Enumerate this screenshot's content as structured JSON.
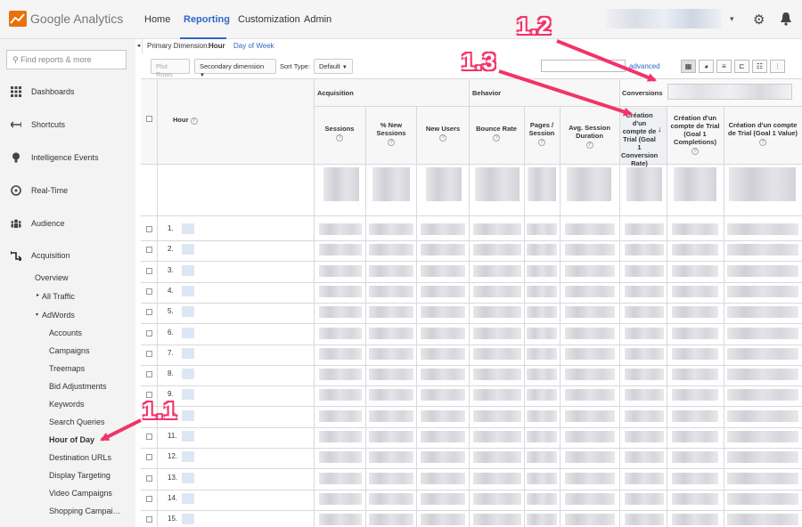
{
  "topbar": {
    "logo_text": "Google Analytics",
    "tabs": [
      "Home",
      "Reporting",
      "Customization",
      "Admin"
    ],
    "active_tab": "Reporting",
    "account_caret": "▾"
  },
  "sidebar": {
    "search_placeholder": "Find reports & more",
    "items": [
      {
        "label": "Dashboards",
        "icon": "grid-icon"
      },
      {
        "label": "Shortcuts",
        "icon": "shortcut-icon"
      },
      {
        "label": "Intelligence Events",
        "icon": "bulb-icon"
      },
      {
        "label": "Real-Time",
        "icon": "clock-icon"
      },
      {
        "label": "Audience",
        "icon": "people-icon"
      },
      {
        "label": "Acquisition",
        "icon": "acquisition-icon"
      }
    ],
    "acquisition_children": {
      "overview": "Overview",
      "all_traffic": "All Traffic",
      "adwords": "AdWords",
      "adwords_children": [
        "Accounts",
        "Campaigns",
        "Treemaps",
        "Bid Adjustments",
        "Keywords",
        "Search Queries",
        "Hour of Day",
        "Destination URLs",
        "Display Targeting",
        "Video Campaigns",
        "Shopping Campai…"
      ],
      "active_child": "Hour of Day"
    }
  },
  "dimension_bar": {
    "collapse": "◂",
    "label": "Primary Dimension:",
    "active": "Hour",
    "alt": "Day of Week"
  },
  "toolbar": {
    "plot_rows": "Plot Rows",
    "secondary_dimension": "Secondary dimension",
    "sort_type_label": "Sort Type:",
    "sort_type_value": "Default",
    "advanced": "advanced"
  },
  "table": {
    "groups": {
      "acquisition": "Acquisition",
      "behavior": "Behavior",
      "conversions": "Conversions"
    },
    "columns": {
      "hour": "Hour",
      "sessions": "Sessions",
      "new_sessions": "% New Sessions",
      "new_users": "New Users",
      "bounce_rate": "Bounce Rate",
      "pages_session": "Pages / Session",
      "avg_duration": "Avg. Session Duration",
      "conv_rate": "Création d'un compte de Trial (Goal 1 Conversion Rate)",
      "completions": "Création d'un compte de Trial (Goal 1 Completions)",
      "value": "Création d'un compte de Trial (Goal 1 Value)"
    },
    "sort_arrow": "↓",
    "rows": [
      "1.",
      "2.",
      "3.",
      "4.",
      "5.",
      "6.",
      "7.",
      "8.",
      "9.",
      "10.",
      "11.",
      "12.",
      "13.",
      "14.",
      "15."
    ]
  },
  "annotations": [
    "1.1",
    "1.2",
    "1.3"
  ],
  "colors": {
    "accent": "#3166c5",
    "annotation": "#f2336a",
    "sidebar_bg": "#f3f3f3"
  }
}
